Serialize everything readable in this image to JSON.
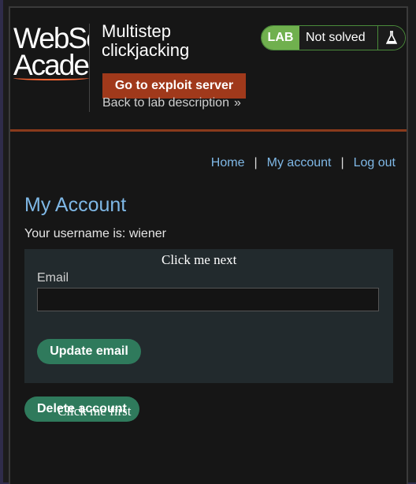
{
  "header": {
    "logo_line1": "WebSe",
    "logo_line2": "Acade",
    "title": "Multistep clickjacking",
    "exploit_button": "Go to exploit server",
    "back_link": "Back to lab description",
    "status_tag": "LAB",
    "status_text": "Not solved",
    "status_icon": "flask-icon"
  },
  "nav": {
    "home": "Home",
    "my_account": "My account",
    "log_out": "Log out",
    "separator": "|"
  },
  "account": {
    "title": "My Account",
    "username_text": "Your username is: wiener",
    "email_label": "Email",
    "email_value": "",
    "update_button": "Update email",
    "delete_button": "Delete account"
  },
  "decoys": {
    "next": "Click me next",
    "first": "Click me first"
  },
  "colors": {
    "accent_link": "#7fb8e6",
    "exploit_button": "#a0391b",
    "action_button": "#2f7a5c",
    "lab_tag": "#70b04e",
    "rule": "#8a3a1c"
  }
}
